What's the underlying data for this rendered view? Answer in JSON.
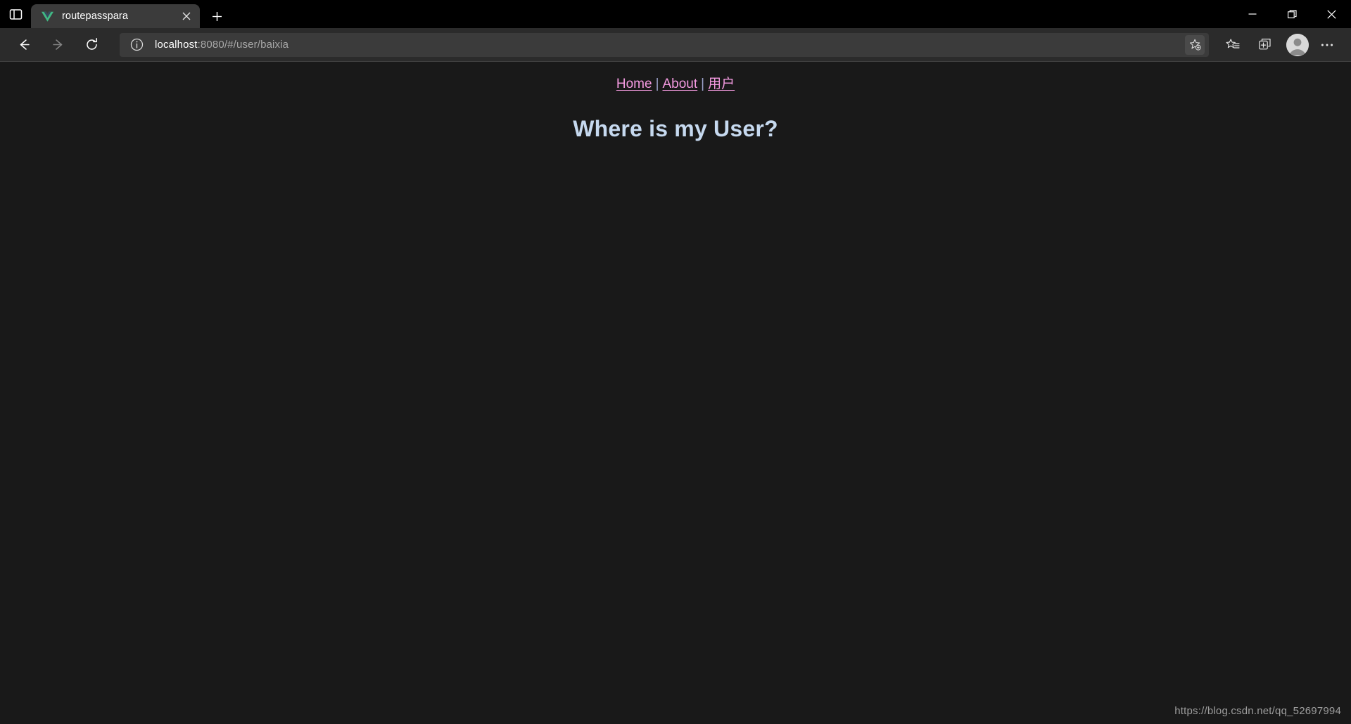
{
  "window": {
    "controls": {
      "minimize_label": "Minimize",
      "maximize_label": "Restore",
      "close_label": "Close"
    }
  },
  "tabstrip": {
    "sidebar_toggle_label": "Tab actions menu",
    "new_tab_label": "New tab",
    "tabs": [
      {
        "title": "routepasspara",
        "favicon": "vue-logo-icon",
        "close_label": "Close tab",
        "active": true
      }
    ]
  },
  "toolbar": {
    "back_label": "Back",
    "forward_label": "Forward",
    "refresh_label": "Refresh",
    "site_info_label": "View site information",
    "url_host": "localhost",
    "url_rest": ":8080/#/user/baixia",
    "url_full": "localhost:8080/#/user/baixia",
    "add_favorite_label": "Add this page to favorites",
    "favorites_label": "Favorites",
    "collections_label": "Collections",
    "profile_label": "Profile",
    "settings_label": "Settings and more"
  },
  "page": {
    "nav": {
      "links": [
        {
          "label": "Home"
        },
        {
          "label": "About"
        },
        {
          "label": "用户"
        }
      ],
      "separator": "|"
    },
    "heading": "Where is my User?",
    "watermark": "https://blog.csdn.net/qq_52697994"
  },
  "colors": {
    "page_bg": "#191919",
    "link": "#f39ae0",
    "heading": "#c6d9ef",
    "tab_active_bg": "#3b3b3b",
    "toolbar_bg": "#2b2b2b",
    "omnibox_bg": "#3b3b3b",
    "vue_green": "#41b883",
    "vue_dark": "#35495e"
  }
}
